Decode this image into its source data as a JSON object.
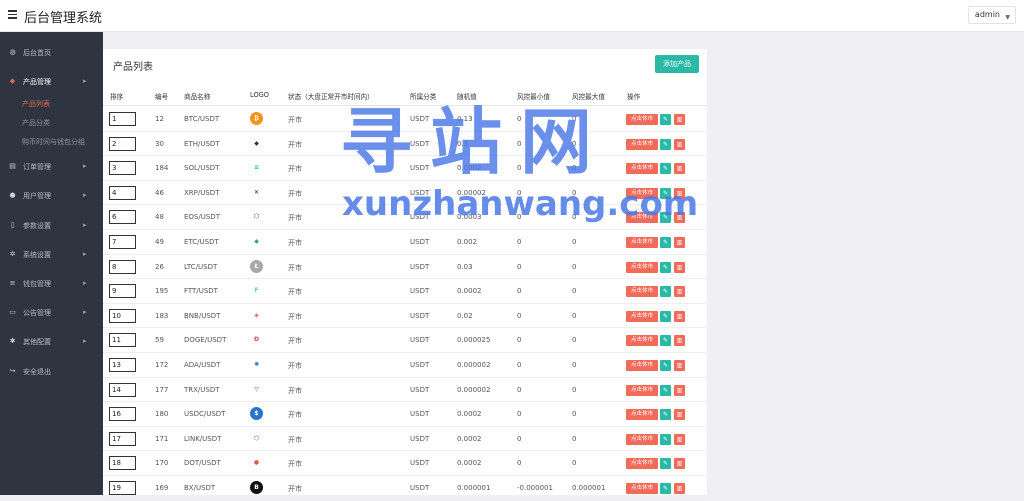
{
  "header": {
    "title": "后台管理系统",
    "user": "admin"
  },
  "sidebar": {
    "items": [
      {
        "label": "后台首页",
        "icon": "dashboard-icon",
        "glyph": "◍"
      },
      {
        "label": "产品管理",
        "icon": "product-icon",
        "glyph": "◆",
        "active": true
      },
      {
        "label": "订单管理",
        "icon": "order-icon",
        "glyph": "▤"
      },
      {
        "label": "用户管理",
        "icon": "user-icon",
        "glyph": "●"
      },
      {
        "label": "参数设置",
        "icon": "settings-doc-icon",
        "glyph": "▯"
      },
      {
        "label": "系统设置",
        "icon": "gear-icon",
        "glyph": "✲"
      },
      {
        "label": "钱包管理",
        "icon": "wallet-icon",
        "glyph": "≡"
      },
      {
        "label": "公告管理",
        "icon": "notice-icon",
        "glyph": "▭"
      },
      {
        "label": "其他配置",
        "icon": "config-icon",
        "glyph": "✱"
      },
      {
        "label": "安全退出",
        "icon": "logout-icon",
        "glyph": "↪"
      }
    ],
    "sub_items": [
      "产品列表",
      "产品分类",
      "购币时间与钱包分组"
    ]
  },
  "panel": {
    "title": "产品列表",
    "add_button": "添加产品",
    "columns": [
      "排序",
      "编号",
      "商品名称",
      "LOGO",
      "状态（大盘正常开市时间内）",
      "所属分类",
      "随机值",
      "风控最小值",
      "风控最大值",
      "操作"
    ]
  },
  "rows": [
    {
      "sort": "1",
      "id": "12",
      "name": "BTC/USDT",
      "logo": "bitcoin-logo-icon",
      "status": "开市",
      "category": "USDT",
      "random": "0.13",
      "min": "0",
      "max": "0"
    },
    {
      "sort": "2",
      "id": "30",
      "name": "ETH/USDT",
      "logo": "ethereum-logo-icon",
      "status": "开市",
      "category": "USDT",
      "random": "0.3",
      "min": "0",
      "max": "0"
    },
    {
      "sort": "3",
      "id": "184",
      "name": "SOL/USDT",
      "logo": "solana-logo-icon",
      "status": "开市",
      "category": "USDT",
      "random": "0.0002",
      "min": "0",
      "max": "0"
    },
    {
      "sort": "4",
      "id": "46",
      "name": "XRP/USDT",
      "logo": "xrp-logo-icon",
      "status": "开市",
      "category": "USDT",
      "random": "0.00002",
      "min": "0",
      "max": "0"
    },
    {
      "sort": "6",
      "id": "48",
      "name": "EOS/USDT",
      "logo": "eos-logo-icon",
      "status": "开市",
      "category": "USDT",
      "random": "0.0003",
      "min": "0",
      "max": "0"
    },
    {
      "sort": "7",
      "id": "49",
      "name": "ETC/USDT",
      "logo": "etc-logo-icon",
      "status": "开市",
      "category": "USDT",
      "random": "0.002",
      "min": "0",
      "max": "0"
    },
    {
      "sort": "8",
      "id": "26",
      "name": "LTC/USDT",
      "logo": "litecoin-logo-icon",
      "status": "开市",
      "category": "USDT",
      "random": "0.03",
      "min": "0",
      "max": "0"
    },
    {
      "sort": "9",
      "id": "195",
      "name": "FTT/USDT",
      "logo": "ftt-logo-icon",
      "status": "开市",
      "category": "USDT",
      "random": "0.0002",
      "min": "0",
      "max": "0"
    },
    {
      "sort": "10",
      "id": "183",
      "name": "BNB/USDT",
      "logo": "bnb-logo-icon",
      "status": "开市",
      "category": "USDT",
      "random": "0.02",
      "min": "0",
      "max": "0"
    },
    {
      "sort": "11",
      "id": "59",
      "name": "DOGE/USDT",
      "logo": "doge-logo-icon",
      "status": "开市",
      "category": "USDT",
      "random": "0.000025",
      "min": "0",
      "max": "0"
    },
    {
      "sort": "13",
      "id": "172",
      "name": "ADA/USDT",
      "logo": "cardano-logo-icon",
      "status": "开市",
      "category": "USDT",
      "random": "0.000002",
      "min": "0",
      "max": "0"
    },
    {
      "sort": "14",
      "id": "177",
      "name": "TRX/USDT",
      "logo": "tron-logo-icon",
      "status": "开市",
      "category": "USDT",
      "random": "0.000002",
      "min": "0",
      "max": "0"
    },
    {
      "sort": "16",
      "id": "180",
      "name": "USDC/USDT",
      "logo": "usdc-logo-icon",
      "status": "开市",
      "category": "USDT",
      "random": "0.0002",
      "min": "0",
      "max": "0"
    },
    {
      "sort": "17",
      "id": "171",
      "name": "LINK/USDT",
      "logo": "chainlink-logo-icon",
      "status": "开市",
      "category": "USDT",
      "random": "0.0002",
      "min": "0",
      "max": "0"
    },
    {
      "sort": "18",
      "id": "170",
      "name": "DOT/USDT",
      "logo": "polkadot-logo-icon",
      "status": "开市",
      "category": "USDT",
      "random": "0.0002",
      "min": "0",
      "max": "0"
    },
    {
      "sort": "19",
      "id": "169",
      "name": "BX/USDT",
      "logo": "bx-logo-icon",
      "status": "开市",
      "category": "USDT",
      "random": "0.000001",
      "min": "-0.000001",
      "max": "0.000001"
    }
  ],
  "row_actions": {
    "close_label": "点击休市",
    "edit_icon": "pencil-icon",
    "delete_icon": "trash-icon"
  },
  "watermark": {
    "text": "寻站网",
    "url": "xunzhanwang.com"
  },
  "colors": {
    "accent": "#29b9a6",
    "danger": "#f26a5a",
    "sidebar": "#2f3540",
    "active_text": "#e8664f",
    "watermark": "#4b78e6"
  }
}
